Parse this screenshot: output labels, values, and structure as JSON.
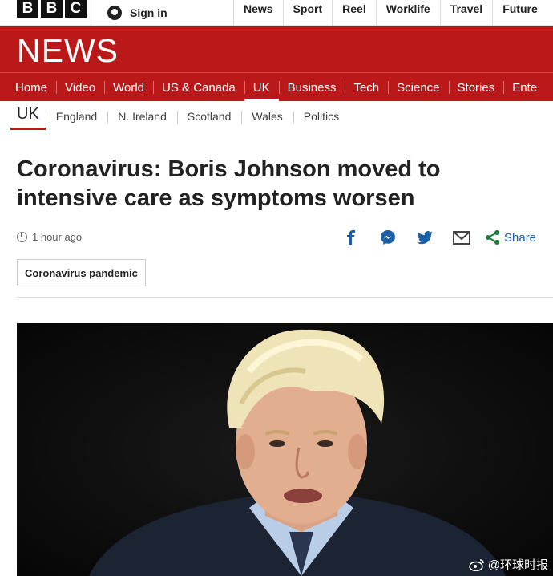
{
  "topbar": {
    "logo_letters": [
      "B",
      "B",
      "C"
    ],
    "signin_label": "Sign in",
    "nav": [
      "News",
      "Sport",
      "Reel",
      "Worklife",
      "Travel",
      "Future"
    ]
  },
  "header": {
    "wordmark": "NEWS",
    "brand_color": "#bb1919"
  },
  "mainnav": {
    "items": [
      "Home",
      "Video",
      "World",
      "US & Canada",
      "UK",
      "Business",
      "Tech",
      "Science",
      "Stories",
      "Ente"
    ],
    "active": "UK"
  },
  "subnav": {
    "current": "UK",
    "items": [
      "England",
      "N. Ireland",
      "Scotland",
      "Wales",
      "Politics"
    ]
  },
  "article": {
    "headline": "Coronavirus: Boris Johnson moved to intensive care as symptoms worsen",
    "timestamp": "1 hour ago",
    "tag": "Coronavirus pandemic",
    "share_label": "Share",
    "share_icons": [
      "facebook-icon",
      "messenger-icon",
      "twitter-icon",
      "email-icon",
      "share-icon"
    ]
  },
  "watermark": {
    "text": "@环球时报"
  }
}
